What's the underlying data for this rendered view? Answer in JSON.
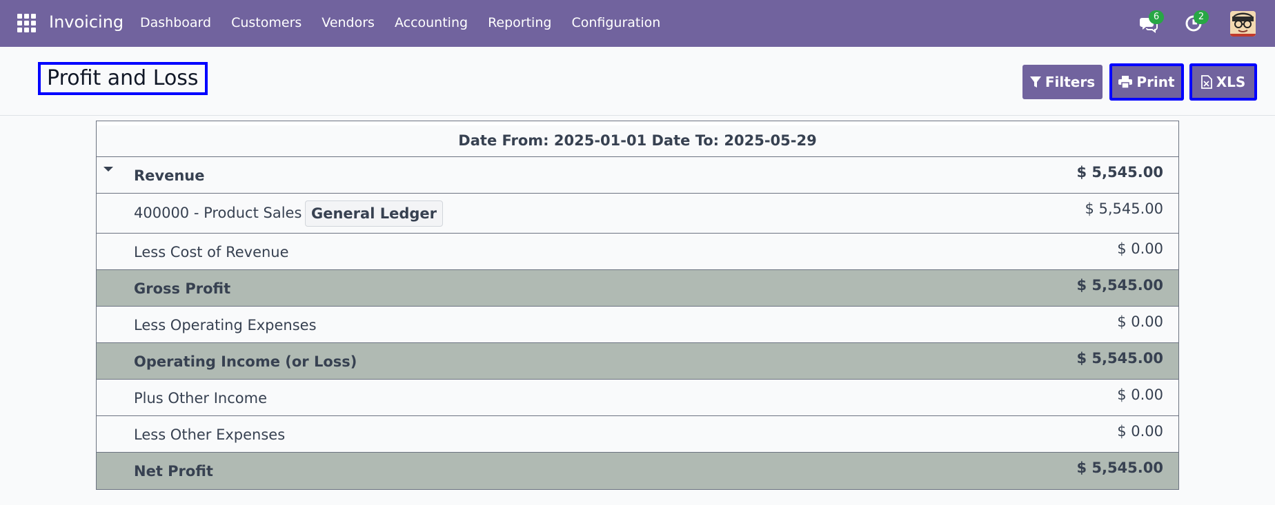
{
  "navbar": {
    "app_name": "Invoicing",
    "menu": [
      "Dashboard",
      "Customers",
      "Vendors",
      "Accounting",
      "Reporting",
      "Configuration"
    ],
    "messages_badge": "6",
    "activities_badge": "2",
    "colors": {
      "bar": "#71639e",
      "badge": "#28a745"
    }
  },
  "control_panel": {
    "title": "Profit and Loss",
    "filters_label": "Filters",
    "print_label": "Print",
    "xls_label": "XLS"
  },
  "report": {
    "header": "Date From: 2025-01-01 Date To: 2025-05-29",
    "rows": [
      {
        "label": "Revenue",
        "amount": "$ 5,545.00",
        "style": "bold",
        "expandable": true
      },
      {
        "label": "400000 - Product Sales",
        "amount": "$ 5,545.00",
        "style": "normal",
        "action": "General Ledger"
      },
      {
        "label": "Less Cost of Revenue",
        "amount": "$ 0.00",
        "style": "normal"
      },
      {
        "label": "Gross Profit",
        "amount": "$ 5,545.00",
        "style": "total"
      },
      {
        "label": "Less Operating Expenses",
        "amount": "$ 0.00",
        "style": "normal"
      },
      {
        "label": "Operating Income (or Loss)",
        "amount": "$ 5,545.00",
        "style": "total"
      },
      {
        "label": "Plus Other Income",
        "amount": "$ 0.00",
        "style": "normal"
      },
      {
        "label": "Less Other Expenses",
        "amount": "$ 0.00",
        "style": "normal"
      },
      {
        "label": "Net Profit",
        "amount": "$ 5,545.00",
        "style": "total"
      }
    ],
    "colors": {
      "total_row": "#b0bab3",
      "border": "#6b7280"
    }
  }
}
